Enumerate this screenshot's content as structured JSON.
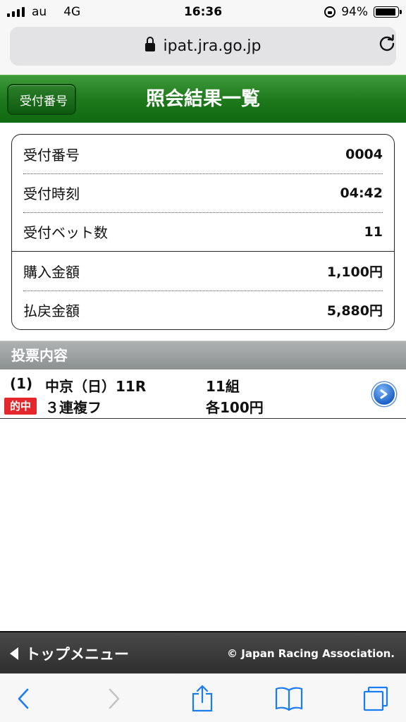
{
  "status_bar": {
    "carrier": "au",
    "network": "4G",
    "time": "16:36",
    "battery_percent": "94%",
    "battery_level": 0.94
  },
  "browser": {
    "url": "ipat.jra.go.jp"
  },
  "header": {
    "back_label": "受付番号",
    "title": "照会結果一覧",
    "color": "#1e7a1c"
  },
  "info": {
    "rows": [
      {
        "label": "受付番号",
        "value": "0004"
      },
      {
        "label": "受付時刻",
        "value": "04:42"
      },
      {
        "label": "受付ベット数",
        "value": "11"
      },
      {
        "label": "購入金額",
        "value": "1,100円"
      },
      {
        "label": "払戻金額",
        "value": "5,880円"
      }
    ]
  },
  "section": {
    "title": "投票内容"
  },
  "bet": {
    "number": "(1)",
    "race": "中京（日）11R",
    "combos": "11組",
    "hit_badge": "的中",
    "bet_type": "３連複フ",
    "unit_amount": "各100円",
    "hit_color": "#e5262a"
  },
  "footer": {
    "top_menu_label": "トップメニュー",
    "copyright": "© Japan Racing Association."
  },
  "toolbar": {
    "icons": [
      "back-icon",
      "forward-icon",
      "share-icon",
      "bookmarks-icon",
      "tabs-icon"
    ]
  }
}
